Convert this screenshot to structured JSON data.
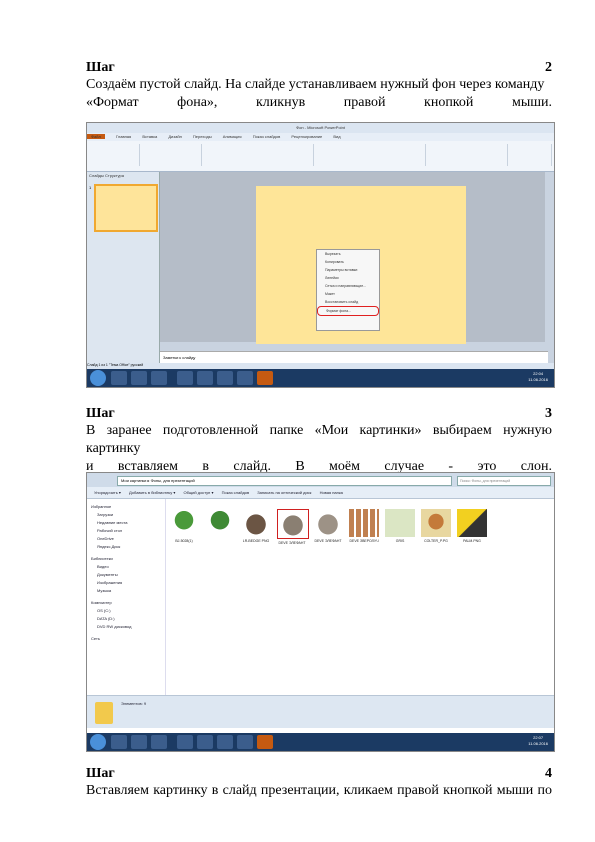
{
  "steps": [
    {
      "label": "Шаг",
      "number": "2",
      "text_line1": "Создаём пустой слайд. На слайде устанавливаем нужный фон через команду",
      "text_line2": "«Формат фона», кликнув правой кнопкой мыши."
    },
    {
      "label": "Шаг",
      "number": "3",
      "text_line1": "В заранее подготовленной папке «Мои картинки» выбираем нужную картинку",
      "text_line2": "и вставляем в слайд. В моём случае - это слон."
    },
    {
      "label": "Шаг",
      "number": "4",
      "text_line1": "Вставляем картинку в слайд презентации, кликаем правой кнопкой мыши по"
    }
  ],
  "ppt": {
    "title": "Фон - Microsoft PowerPoint",
    "tabs": [
      "Файл",
      "Главная",
      "Вставка",
      "Дизайн",
      "Переходы",
      "Анимация",
      "Показ слайдов",
      "Рецензирование",
      "Вид"
    ],
    "panel_tabs": "Слайды  Структура",
    "slide_number": "1",
    "context_menu": [
      "Вырезать",
      "Копировать",
      "Параметры вставки:",
      "Линейки",
      "Сетка и направляющие...",
      "Макет",
      "Восстановить слайд",
      "Формат фона..."
    ],
    "notes_placeholder": "Заметки к слайду",
    "status": "Слайд 1 из 1   \"Тема Office\"   русский",
    "clock_time": "22:04",
    "clock_date": "11.06.2016"
  },
  "explorer": {
    "address": "Мои картинки ▸ Фоны, для презентаций",
    "search_placeholder": "Поиск: Фоны, для презентаций",
    "toolbar": [
      "Упорядочить ▾",
      "Добавить в библиотеку ▾",
      "Общий доступ ▾",
      "Показ слайдов",
      "Записать на оптический диск",
      "Новая папка"
    ],
    "nav": {
      "favorites": "Избранное",
      "fav_items": [
        "Загрузки",
        "Недавние места",
        "Рабочий стол",
        "OneDrive",
        "Яндекс.Диск"
      ],
      "libraries": "Библиотеки",
      "lib_items": [
        "Видео",
        "Документы",
        "Изображения",
        "Музыка"
      ],
      "computer": "Компьютер",
      "comp_items": [
        "OS (C:)",
        "DATA (D:)",
        "DVD RW дисковод"
      ],
      "network": "Сеть"
    },
    "files": [
      "BJ-5028(1)",
      "",
      "LR-BEDGE PNG",
      "DEVE ЭЛЕФАНТ",
      "DEVE ЭЛЕФАНТ",
      "DEVE ЗВЕРОЛУЧ",
      "GRIS",
      "COLTER_P.PG",
      "PALM.PNG"
    ],
    "count": "Элементов: 9",
    "clock_time": "22:07",
    "clock_date": "11.06.2016"
  }
}
